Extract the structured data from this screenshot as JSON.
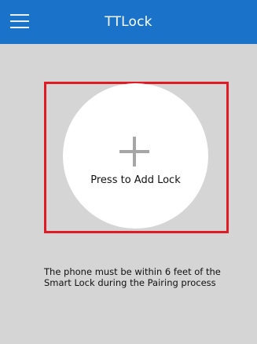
{
  "header": {
    "title": "TTLock",
    "menu_icon": "hamburger-menu-icon",
    "background_color": "#1a73c8"
  },
  "main": {
    "add_button_label": "Press to Add Lock",
    "add_icon": "plus-icon",
    "highlight_color": "#e01b24",
    "hint_text": "The phone must be within 6 feet of the Smart Lock during the Pairing process"
  }
}
